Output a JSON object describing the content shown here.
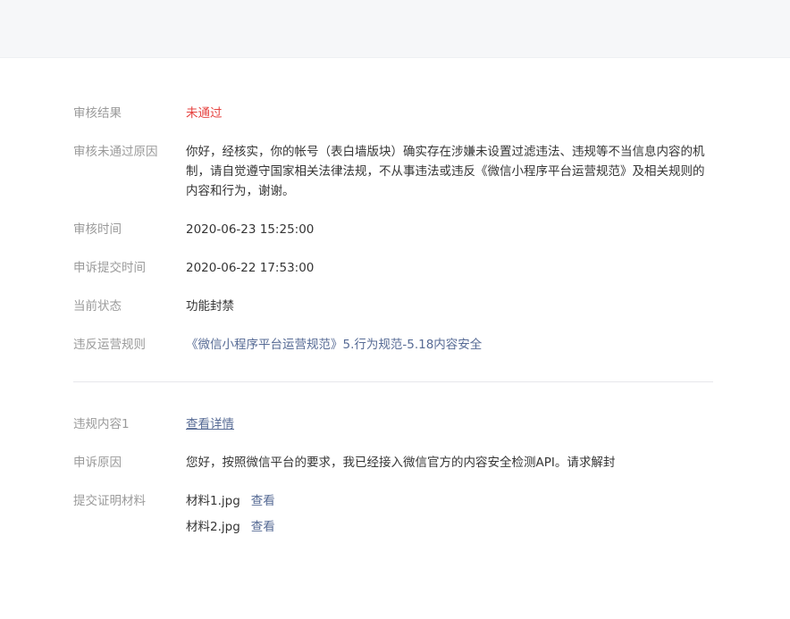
{
  "review": {
    "result": {
      "label": "审核结果",
      "value": "未通过"
    },
    "reason": {
      "label": "审核未通过原因",
      "value": "你好，经核实，你的帐号（表白墙版块）确实存在涉嫌未设置过滤违法、违规等不当信息内容的机制，请自觉遵守国家相关法律法规，不从事违法或违反《微信小程序平台运营规范》及相关规则的内容和行为，谢谢。"
    },
    "review_time": {
      "label": "审核时间",
      "value": "2020-06-23 15:25:00"
    },
    "appeal_time": {
      "label": "申诉提交时间",
      "value": "2020-06-22 17:53:00"
    },
    "status": {
      "label": "当前状态",
      "value": "功能封禁"
    },
    "rule": {
      "label": "违反运营规则",
      "value": "《微信小程序平台运营规范》5.行为规范-5.18内容安全"
    }
  },
  "appeal": {
    "content": {
      "label": "违规内容1",
      "link": "查看详情"
    },
    "appeal_reason": {
      "label": "申诉原因",
      "value": "您好，按照微信平台的要求，我已经接入微信官方的内容安全检测API。请求解封"
    },
    "materials": {
      "label": "提交证明材料",
      "files": [
        {
          "name": "材料1.jpg",
          "action": "查看"
        },
        {
          "name": "材料2.jpg",
          "action": "查看"
        }
      ]
    }
  },
  "colors": {
    "fail": "#e64340",
    "link": "#576b95",
    "label": "#9a9a9a"
  }
}
